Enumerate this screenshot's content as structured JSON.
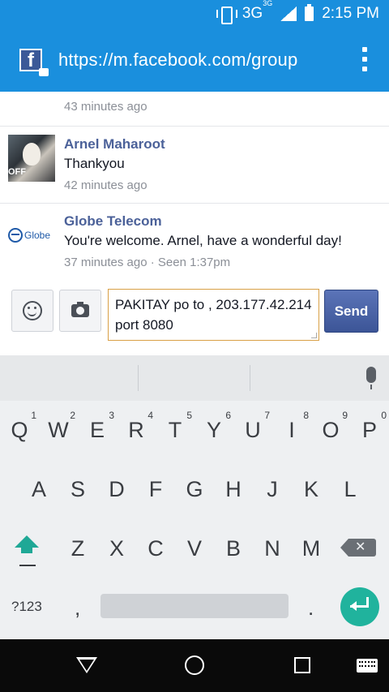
{
  "status_bar": {
    "network": "3G",
    "network_sup": "3G",
    "time": "2:15 PM"
  },
  "url_bar": {
    "url": "https://m.facebook.com/group"
  },
  "messages": {
    "prev_time": "43 minutes ago",
    "items": [
      {
        "sender": "Arnel Maharoot",
        "text": "Thankyou",
        "meta": "42 minutes ago"
      },
      {
        "sender": "Globe Telecom",
        "avatar_text": "Globe",
        "text": "You're welcome. Arnel, have a wonderful day!",
        "meta": "37 minutes ago · Seen 1:37pm"
      }
    ]
  },
  "composer": {
    "input_value": "PAKITAY po to , 203.177.42.214 port 8080",
    "send_label": "Send"
  },
  "keyboard": {
    "row1": [
      {
        "k": "Q",
        "n": "1"
      },
      {
        "k": "W",
        "n": "2"
      },
      {
        "k": "E",
        "n": "3"
      },
      {
        "k": "R",
        "n": "4"
      },
      {
        "k": "T",
        "n": "5"
      },
      {
        "k": "Y",
        "n": "6"
      },
      {
        "k": "U",
        "n": "7"
      },
      {
        "k": "I",
        "n": "8"
      },
      {
        "k": "O",
        "n": "9"
      },
      {
        "k": "P",
        "n": "0"
      }
    ],
    "row2": [
      "A",
      "S",
      "D",
      "F",
      "G",
      "H",
      "J",
      "K",
      "L"
    ],
    "row3": [
      "Z",
      "X",
      "C",
      "V",
      "B",
      "N",
      "M"
    ],
    "symbols_label": "?123",
    "comma": ",",
    "period": "."
  },
  "icons": {
    "vibrate": "vibrate-icon",
    "signal": "signal-icon",
    "battery": "battery-icon",
    "facebook_lock": "facebook-lock-icon",
    "menu": "overflow-menu-icon",
    "emoji": "emoji-icon",
    "camera": "camera-icon",
    "mic": "microphone-icon",
    "shift": "shift-icon",
    "backspace": "backspace-icon",
    "enter": "enter-icon",
    "back": "back-icon",
    "home": "home-icon",
    "recents": "recents-icon",
    "keyboard": "keyboard-icon"
  },
  "colors": {
    "accent": "#1a8fdd",
    "send": "#3c5597",
    "kb_accent": "#1fa896"
  }
}
